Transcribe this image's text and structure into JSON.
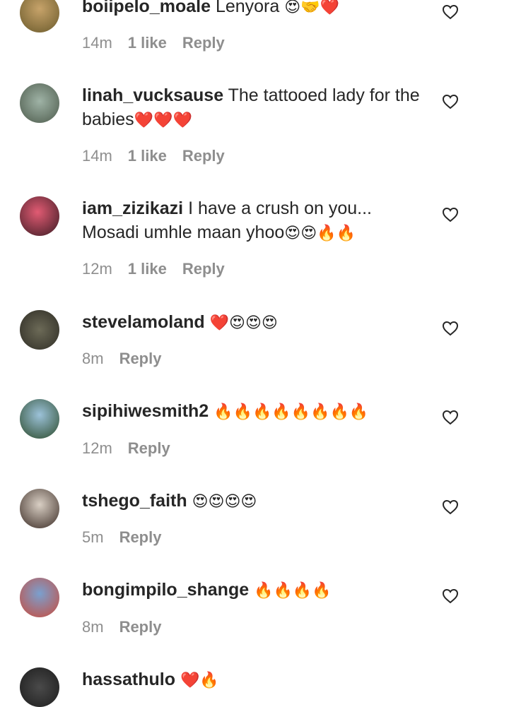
{
  "comments": [
    {
      "username": "boiipelo_moale",
      "text": "Lenyora",
      "emojis": "😍🤝❤️",
      "time": "14m",
      "likes": "1 like",
      "reply": "Reply",
      "avatar_colors": [
        "#c7a36a",
        "#6a5a2b"
      ]
    },
    {
      "username": "linah_vucksause",
      "text": "The tattooed lady for the babies",
      "emojis": "❤️❤️❤️",
      "time": "14m",
      "likes": "1 like",
      "reply": "Reply",
      "avatar_colors": [
        "#9fb3a6",
        "#4c5a4b"
      ]
    },
    {
      "username": "iam_zizikazi",
      "text": "I have a crush on you... Mosadi umhle maan yhoo",
      "emojis": "😍😍🔥🔥",
      "time": "12m",
      "likes": "1 like",
      "reply": "Reply",
      "avatar_colors": [
        "#e15b73",
        "#3a1a22"
      ]
    },
    {
      "username": "stevelamoland",
      "text": "",
      "emojis": "❤️😍😍😍",
      "time": "8m",
      "likes": "",
      "reply": "Reply",
      "avatar_colors": [
        "#6c6a57",
        "#2f2d25"
      ]
    },
    {
      "username": "sipihiwesmith2",
      "text": "",
      "emojis": "🔥🔥🔥🔥🔥🔥🔥🔥",
      "time": "12m",
      "likes": "",
      "reply": "Reply",
      "avatar_colors": [
        "#9cc2d9",
        "#2b4a2b"
      ]
    },
    {
      "username": "tshego_faith",
      "text": "",
      "emojis": "😍😍😍😍",
      "time": "5m",
      "likes": "",
      "reply": "Reply",
      "avatar_colors": [
        "#d9cfc4",
        "#3b2c25"
      ]
    },
    {
      "username": "bongimpilo_shange",
      "text": "",
      "emojis": "🔥🔥🔥🔥",
      "time": "8m",
      "likes": "",
      "reply": "Reply",
      "avatar_colors": [
        "#7aa0cf",
        "#c94b3c"
      ]
    },
    {
      "username": "hassathulo",
      "text": "",
      "emojis": "❤️🔥",
      "time": "",
      "likes": "",
      "reply": "",
      "avatar_colors": [
        "#1d1d1d",
        "#4a4a4a"
      ]
    }
  ],
  "icons": {
    "like": "heart-outline-icon"
  }
}
